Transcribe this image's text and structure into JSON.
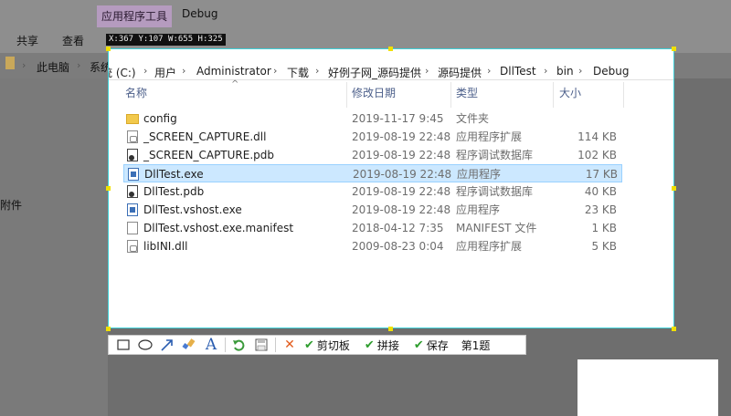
{
  "ribbon": {
    "tab_tools": "应用程序工具",
    "tab_debug": "Debug",
    "tab_share": "共享",
    "tab_view": "查看",
    "selection_info": "X:367 Y:107 W:655 H:325"
  },
  "sidebar": {
    "partial_label": "附件"
  },
  "breadcrumb": [
    "此电脑",
    "系统 (C:)",
    "用户",
    "Administrator",
    "下载",
    "好例子网_源码提供",
    "源码提供",
    "DllTest",
    "bin",
    "Debug"
  ],
  "columns": {
    "name": "名称",
    "date": "修改日期",
    "type": "类型",
    "size": "大小"
  },
  "files": [
    {
      "name": "config",
      "date": "2019-11-17 9:45",
      "type": "文件夹",
      "size": "",
      "icon": "folder-icon"
    },
    {
      "name": "_SCREEN_CAPTURE.dll",
      "date": "2019-08-19 22:48",
      "type": "应用程序扩展",
      "size": "114 KB",
      "icon": "dll-icon"
    },
    {
      "name": "_SCREEN_CAPTURE.pdb",
      "date": "2019-08-19 22:48",
      "type": "程序调试数据库",
      "size": "102 KB",
      "icon": "pdb-icon"
    },
    {
      "name": "DllTest.exe",
      "date": "2019-08-19 22:48",
      "type": "应用程序",
      "size": "17 KB",
      "icon": "exe-icon"
    },
    {
      "name": "DllTest.pdb",
      "date": "2019-08-19 22:48",
      "type": "程序调试数据库",
      "size": "40 KB",
      "icon": "pdb-icon"
    },
    {
      "name": "DllTest.vshost.exe",
      "date": "2019-08-19 22:48",
      "type": "应用程序",
      "size": "23 KB",
      "icon": "exe-icon"
    },
    {
      "name": "DllTest.vshost.exe.manifest",
      "date": "2018-04-12 7:35",
      "type": "MANIFEST 文件",
      "size": "1 KB",
      "icon": "file-icon"
    },
    {
      "name": "libINI.dll",
      "date": "2009-08-23 0:04",
      "type": "应用程序扩展",
      "size": "5 KB",
      "icon": "dll-icon"
    }
  ],
  "toolbar": {
    "clip_label": "剪切板",
    "stitch_label": "拼接",
    "save_label": "保存",
    "question_label": "第1题"
  }
}
